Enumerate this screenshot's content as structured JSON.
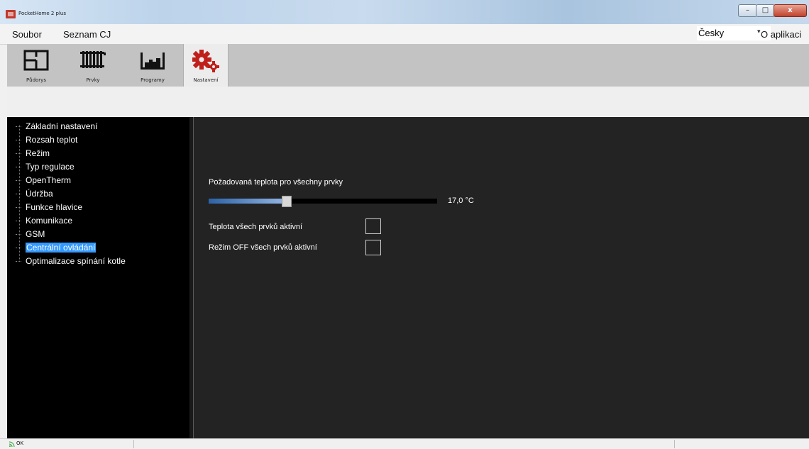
{
  "window": {
    "title": "PocketHome 2 plus",
    "minimize_label": "–",
    "maximize_label": "□",
    "close_label": "x"
  },
  "menu": {
    "file": "Soubor",
    "price_list": "Seznam CJ",
    "language": "Česky",
    "language_arrow": "▾",
    "about": "O aplikaci"
  },
  "toolbar": {
    "buttons": [
      {
        "label": "Půdorys",
        "icon": "floorplan-icon"
      },
      {
        "label": "Prvky",
        "icon": "radiator-icon"
      },
      {
        "label": "Programy",
        "icon": "program-chart-icon"
      },
      {
        "label": "Nastavení",
        "icon": "gears-icon",
        "active": true
      }
    ]
  },
  "tree": {
    "items": [
      "Základní nastavení",
      "Rozsah teplot",
      "Režim",
      "Typ regulace",
      "OpenTherm",
      "Údržba",
      "Funkce hlavice",
      "Komunikace",
      "GSM",
      "Centrální ovládání",
      "Optimalizace spínání kotle"
    ],
    "selected": "Centrální ovládání"
  },
  "content": {
    "setpoint_label": "Požadovaná teplota pro všechny prvky",
    "setpoint_value": "17,0 °C",
    "slider_fraction": 0.34,
    "temp_active_label": "Teplota všech prvků aktivní",
    "temp_active_checked": false,
    "off_active_label": "Režim OFF všech prvků aktivní",
    "off_active_checked": false
  },
  "status": {
    "text": "OK",
    "icon": "signal-icon"
  },
  "colors": {
    "selection": "#3399ff",
    "gear": "#c0201a",
    "panel_dark": "#232323"
  }
}
